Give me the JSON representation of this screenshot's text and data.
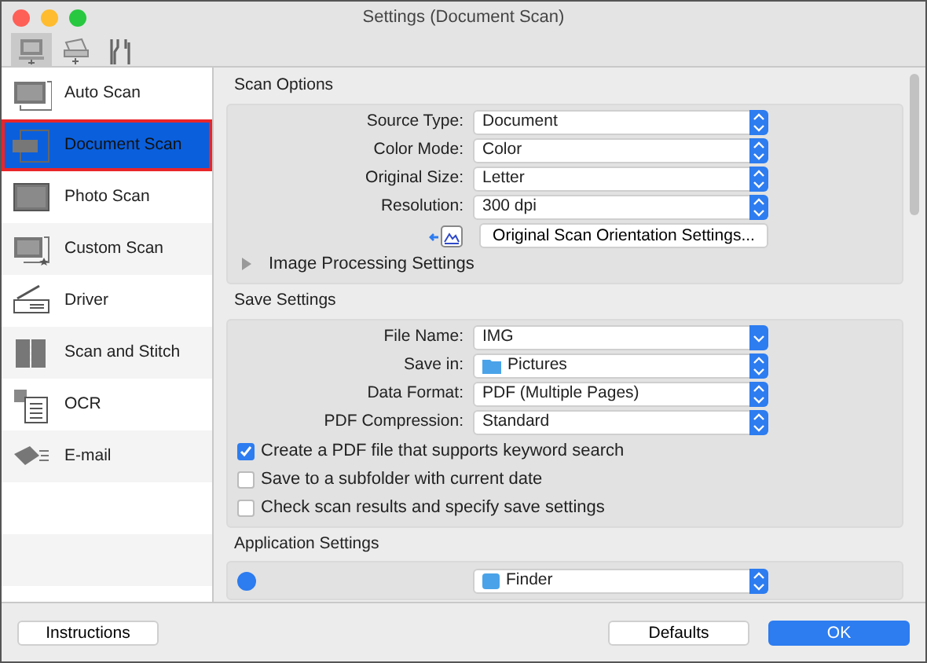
{
  "window": {
    "title": "Settings (Document Scan)"
  },
  "toolbar": [
    {
      "kind": "computer",
      "selected": true
    },
    {
      "kind": "scanner",
      "selected": false
    },
    {
      "kind": "tools",
      "selected": false
    }
  ],
  "sidebar": {
    "items": [
      {
        "kind": "auto",
        "label": "Auto Scan",
        "selected": false,
        "outlined": false
      },
      {
        "kind": "document",
        "label": "Document Scan",
        "selected": true,
        "outlined": true
      },
      {
        "kind": "photo",
        "label": "Photo Scan",
        "selected": false,
        "outlined": false
      },
      {
        "kind": "custom",
        "label": "Custom Scan",
        "selected": false,
        "outlined": false
      },
      {
        "kind": "driver",
        "label": "Driver",
        "selected": false,
        "outlined": false
      },
      {
        "kind": "stitch",
        "label": "Scan and Stitch",
        "selected": false,
        "outlined": false
      },
      {
        "kind": "ocr",
        "label": "OCR",
        "selected": false,
        "outlined": false
      },
      {
        "kind": "email",
        "label": "E-mail",
        "selected": false,
        "outlined": false
      }
    ]
  },
  "sections": [
    {
      "title": "Scan Options",
      "rows": [
        {
          "kind": "select",
          "label": "Source Type:",
          "value": "Document"
        },
        {
          "kind": "select",
          "label": "Color Mode:",
          "value": "Color"
        },
        {
          "kind": "select",
          "label": "Original Size:",
          "value": "Letter"
        },
        {
          "kind": "select",
          "label": "Resolution:",
          "value": "300 dpi"
        },
        {
          "kind": "button",
          "label": "Original Scan Orientation Settings..."
        },
        {
          "kind": "disclosure",
          "label": "Image Processing Settings",
          "expanded": false
        }
      ]
    },
    {
      "title": "Save Settings",
      "rows": [
        {
          "kind": "combo",
          "label": "File Name:",
          "value": "IMG"
        },
        {
          "kind": "folder",
          "label": "Save in:",
          "value": "Pictures"
        },
        {
          "kind": "select",
          "label": "Data Format:",
          "value": "PDF (Multiple Pages)"
        },
        {
          "kind": "select",
          "label": "PDF Compression:",
          "value": "Standard"
        },
        {
          "kind": "checkbox",
          "label": "Create a PDF file that supports keyword search",
          "checked": true
        },
        {
          "kind": "checkbox",
          "label": "Save to a subfolder with current date",
          "checked": false
        },
        {
          "kind": "checkbox",
          "label": "Check scan results and specify save settings",
          "checked": false
        }
      ]
    },
    {
      "title": "Application Settings",
      "rows": [
        {
          "kind": "radio",
          "value": "Finder",
          "selected": true
        }
      ]
    }
  ],
  "footer": [
    {
      "kind": "plain",
      "label": "Instructions"
    },
    {
      "kind": "plain",
      "label": "Defaults"
    },
    {
      "kind": "primary",
      "label": "OK"
    }
  ]
}
